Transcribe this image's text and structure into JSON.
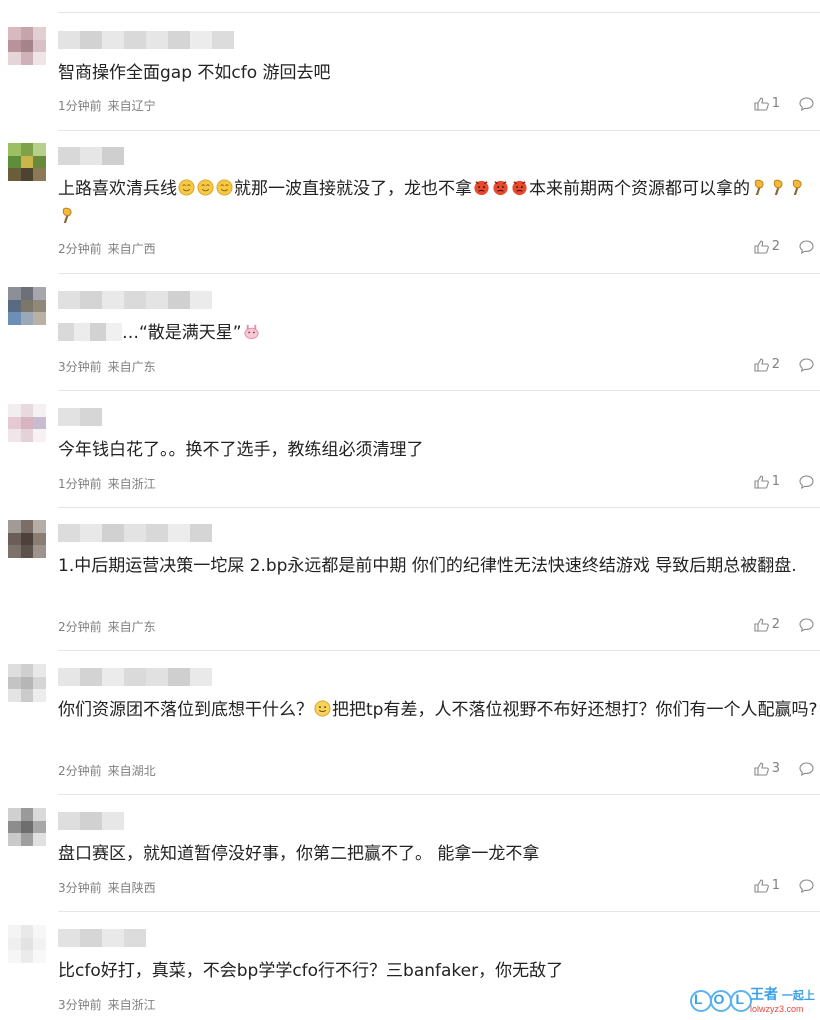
{
  "comments": [
    {
      "text": "智商操作全面gap 不如cfo 游回去吧",
      "time": "1分钟前",
      "location": "来自辽宁",
      "likes": "1"
    },
    {
      "text_a": "上路喜欢清兵线",
      "text_b": "就那一波直接就没了，龙也不拿",
      "text_c": "本来前期两个资源都可以拿的",
      "emoji_a": "smile-emoji",
      "emoji_b": "angry-emoji",
      "emoji_c": "torch-emoji",
      "time": "2分钟前",
      "location": "来自广西",
      "likes": "2"
    },
    {
      "text": "…“散是满天星”",
      "emoji": "rabbit-emoji",
      "time": "3分钟前",
      "location": "来自广东",
      "likes": "2"
    },
    {
      "text": "今年钱白花了。。换不了选手，教练组必须清理了",
      "time": "1分钟前",
      "location": "来自浙江",
      "likes": "1"
    },
    {
      "text": "1.中后期运营决策一坨屎 2.bp永远都是前中期 你们的纪律性无法快速终结游戏 导致后期总被翻盘.",
      "time": "2分钟前",
      "location": "来自广东",
      "likes": "2"
    },
    {
      "text_a": "你们资源团不落位到底想干什么？",
      "text_b": "把把tp有差，人不落位视野不布好还想打？你们有一个人配赢吗?",
      "emoji": "smile-emoji",
      "time": "2分钟前",
      "location": "来自湖北",
      "likes": "3"
    },
    {
      "text": "盘口赛区，就知道暂停没好事，你第二把赢不了。 能拿一龙不拿",
      "time": "3分钟前",
      "location": "来自陕西",
      "likes": "1"
    },
    {
      "text": "比cfo好打，真菜，不会bp学学cfo行不行？三banfaker，你无敌了",
      "time": "3分钟前",
      "location": "来自浙江",
      "likes": ""
    }
  ],
  "watermark": {
    "brand": "LOL",
    "text_a": "王者",
    "text_b": "一起上",
    "domain": "lolwzyz3.com"
  },
  "colors": {
    "meta": "#808080",
    "divider": "#e6e6e6",
    "text": "#222222",
    "watermark_blue": "#3aa0e8"
  }
}
